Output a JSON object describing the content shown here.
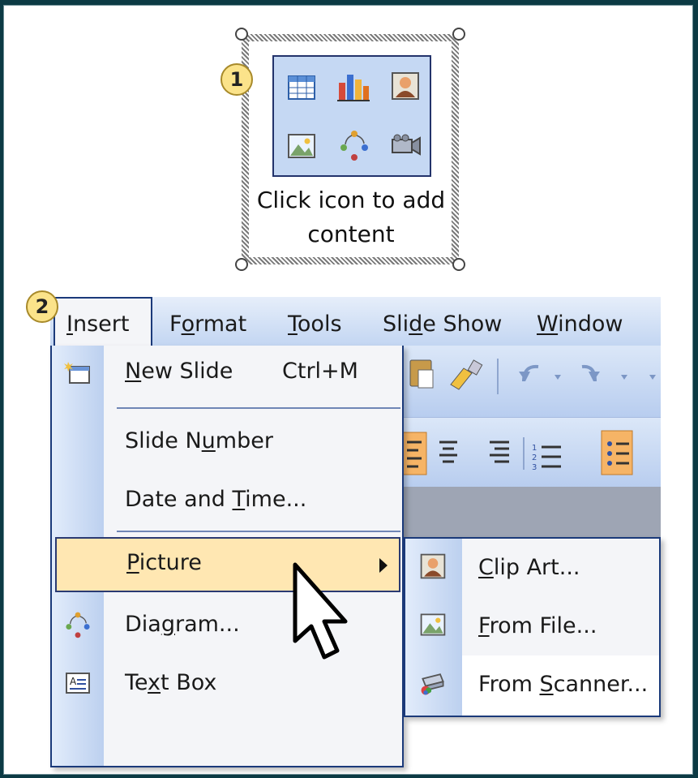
{
  "placeholder": {
    "step": "1",
    "text": "Click icon to add content",
    "icons": [
      "table-icon",
      "chart-icon",
      "clip-art-icon",
      "picture-icon",
      "diagram-icon",
      "media-clip-icon"
    ]
  },
  "menubar": {
    "step": "2",
    "items": [
      "Insert",
      "Format",
      "Tools",
      "Slide Show",
      "Window"
    ]
  },
  "insert_menu": {
    "items": [
      {
        "label": "New Slide",
        "shortcut": "Ctrl+M",
        "icon": "new-slide-icon"
      },
      {
        "label": "Slide Number"
      },
      {
        "label": "Date and Time..."
      },
      {
        "label": "Picture",
        "submenu": true,
        "highlighted": true
      },
      {
        "label": "Diagram...",
        "icon": "diagram-icon"
      },
      {
        "label": "Text Box",
        "icon": "text-box-icon"
      }
    ]
  },
  "picture_submenu": {
    "items": [
      {
        "label": "Clip Art...",
        "icon": "clip-art-icon"
      },
      {
        "label": "From File...",
        "icon": "picture-file-icon"
      },
      {
        "label": "From Scanner...",
        "icon": "scanner-icon"
      }
    ]
  },
  "colors": {
    "background": "#0c3a44",
    "menu_highlight": "#ffe7b2",
    "badge": "#fbe38a",
    "icon_box": "#c5d8f3",
    "border_blue": "#1b3a7a"
  }
}
